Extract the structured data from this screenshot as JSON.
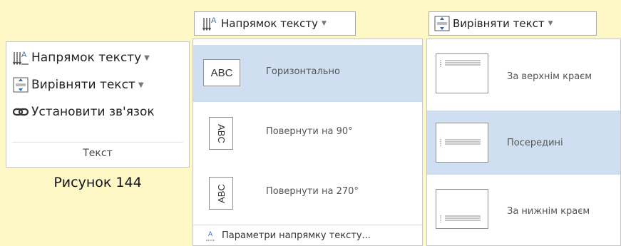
{
  "group": {
    "commands": [
      {
        "label": "Напрямок тексту",
        "icon": "text-direction-icon",
        "has_dropdown": true
      },
      {
        "label": "Вирівняти текст",
        "icon": "align-text-icon",
        "has_dropdown": true
      },
      {
        "label": "Установити зв'язок",
        "icon": "link-icon",
        "has_dropdown": false
      }
    ],
    "label": "Текст"
  },
  "caption": "Рисунок 144",
  "direction_dropdown": {
    "button_label": "Напрямок тексту",
    "items": [
      {
        "label": "Горизонтально",
        "thumb_text": "ABC",
        "rotation": 0,
        "selected": true
      },
      {
        "label": "Повернути на 90°",
        "thumb_text": "ABC",
        "rotation": 90,
        "selected": false
      },
      {
        "label": "Повернути на 270°",
        "thumb_text": "ABC",
        "rotation": 270,
        "selected": false
      }
    ],
    "options_label": "Параметри напрямку тексту..."
  },
  "align_dropdown": {
    "button_label": "Вирівняти текст",
    "items": [
      {
        "label": "За верхнім краєм",
        "position": "top",
        "selected": false
      },
      {
        "label": "Посередині",
        "position": "middle",
        "selected": true
      },
      {
        "label": "За нижнім краєм",
        "position": "bottom",
        "selected": false
      }
    ]
  },
  "colors": {
    "background": "#fdf8c6",
    "selection": "#cfdff1",
    "icon_blue": "#2e6db4"
  }
}
